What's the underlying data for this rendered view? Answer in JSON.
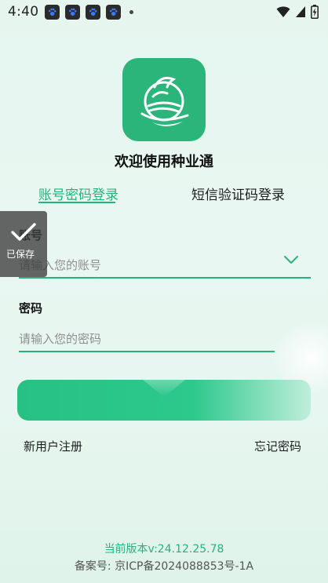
{
  "status_bar": {
    "time": "4:40",
    "notification_icons": [
      "baidu-paw-icon",
      "baidu-paw-icon",
      "baidu-paw-icon",
      "baidu-paw-icon"
    ],
    "indicators": [
      "wifi-icon",
      "signal-icon",
      "battery-icon"
    ]
  },
  "app": {
    "welcome": "欢迎使用种业通",
    "brand_color": "#25b27c"
  },
  "tabs": [
    {
      "label": "账号密码登录",
      "active": true
    },
    {
      "label": "短信验证码登录",
      "active": false
    }
  ],
  "form": {
    "account_label": "账号",
    "account_placeholder": "请输入您的账号",
    "password_label": "密码",
    "password_placeholder": "请输入您的密码"
  },
  "links": {
    "register": "新用户注册",
    "forgot": "忘记密码"
  },
  "footer": {
    "version": "当前版本v:24.12.25.78",
    "icp": "备案号: 京ICP备2024088853号-1A"
  },
  "toast": {
    "text": "已保存"
  }
}
